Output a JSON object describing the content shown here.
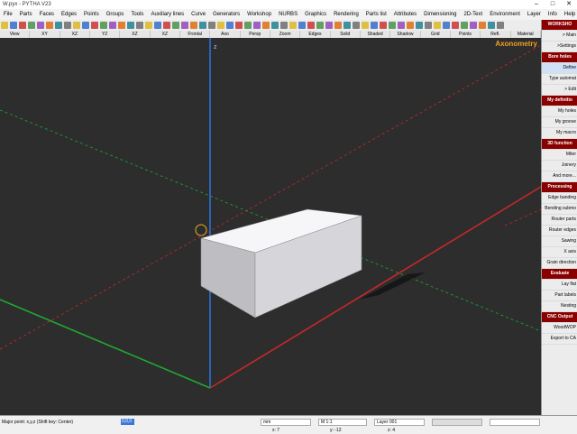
{
  "window": {
    "title": "W.pyx - PYTHA V23"
  },
  "menu": [
    "File",
    "Parts",
    "Faces",
    "Edges",
    "Points",
    "Groups",
    "Tools",
    "Auxiliary lines",
    "Curve",
    "Generators",
    "Workshop",
    "NURBS",
    "Graphics",
    "Rendering",
    "Parts list",
    "Attributes",
    "Dimensioning",
    "2D-Text",
    "Environment",
    "Layer",
    "Info",
    "Help"
  ],
  "viewbar": [
    "View",
    "XY",
    "XZ",
    "YZ",
    "XZ",
    "XZ",
    "Frontal",
    "Axo",
    "Persp",
    "Zoom",
    "Edges",
    "Solid",
    "Shaded",
    "Shadow",
    "Grid",
    "Points",
    "Refl.",
    "Material"
  ],
  "viewport": {
    "view_name": "Axonometry",
    "axis_label": "z"
  },
  "sidebar": [
    {
      "label": "WORKSHO",
      "type": "head"
    },
    {
      "label": "> Main",
      "type": "item"
    },
    {
      "label": ">Settings",
      "type": "item"
    },
    {
      "label": "Bore holes",
      "type": "head"
    },
    {
      "label": "Define",
      "type": "active"
    },
    {
      "label": "Type automat",
      "type": "item"
    },
    {
      "label": "> Edit",
      "type": "item"
    },
    {
      "label": "My definitio",
      "type": "head"
    },
    {
      "label": "My holes",
      "type": "item"
    },
    {
      "label": "My groove",
      "type": "item"
    },
    {
      "label": "My macro",
      "type": "item"
    },
    {
      "label": "3D function",
      "type": "head"
    },
    {
      "label": "Miter",
      "type": "item"
    },
    {
      "label": "Joinery",
      "type": "item"
    },
    {
      "label": "And more...",
      "type": "item"
    },
    {
      "label": "Processing",
      "type": "head"
    },
    {
      "label": "Edge banding",
      "type": "item"
    },
    {
      "label": "Bending submo",
      "type": "item"
    },
    {
      "label": "Router parts",
      "type": "item"
    },
    {
      "label": "Router edges",
      "type": "item"
    },
    {
      "label": "Sawing",
      "type": "item"
    },
    {
      "label": "X axis",
      "type": "item"
    },
    {
      "label": "Grain direction",
      "type": "item"
    },
    {
      "label": "Evaluate",
      "type": "head"
    },
    {
      "label": "Lay flat",
      "type": "item"
    },
    {
      "label": "Part labels",
      "type": "item"
    },
    {
      "label": "Nesting",
      "type": "item"
    },
    {
      "label": "CNC Output",
      "type": "head"
    },
    {
      "label": "WoodWOP",
      "type": "item"
    },
    {
      "label": "Export to CA",
      "type": "item"
    }
  ],
  "status": {
    "prompt": "Major point: x,y,z (Shift key: Center)",
    "coord_input": "0,0,0",
    "unit": "mm",
    "scale": "M 1:1",
    "layer": "Layer 001",
    "coords": [
      "x: 7",
      "y: -12",
      "z: 4"
    ]
  },
  "colors": {
    "x_axis": "#c82828",
    "y_axis": "#1fa830",
    "z_axis": "#2a6fd8",
    "accent": "#f0a020"
  }
}
